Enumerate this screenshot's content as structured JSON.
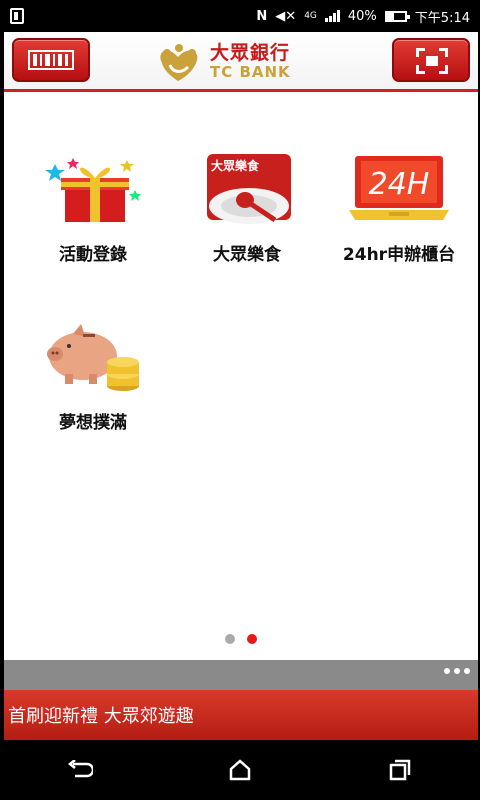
{
  "status_bar": {
    "battery": "40%",
    "battery_level": 0.4,
    "time": "下午5:14",
    "network": "4G"
  },
  "header": {
    "logo_cn": "大眾銀行",
    "logo_en": "TC BANK",
    "left_button_icon": "barcode-icon",
    "right_button_icon": "scan-icon",
    "accent_color": "#c81a1a"
  },
  "menu": {
    "items": [
      {
        "label": "活動登錄",
        "icon": "gift-icon"
      },
      {
        "label": "大眾樂食",
        "icon": "food-icon",
        "badge_text": "大眾樂食"
      },
      {
        "label": "24hr申辦櫃台",
        "icon": "laptop-24h-icon",
        "screen_text": "24H"
      },
      {
        "label": "夢想撲滿",
        "icon": "piggy-bank-icon"
      }
    ]
  },
  "pager": {
    "total": 2,
    "active": 2
  },
  "banner": {
    "text": "首刷迎新禮 大眾郊遊趣"
  },
  "nav": {
    "back_icon": "back-icon",
    "home_icon": "home-icon",
    "recents_icon": "recents-icon"
  }
}
